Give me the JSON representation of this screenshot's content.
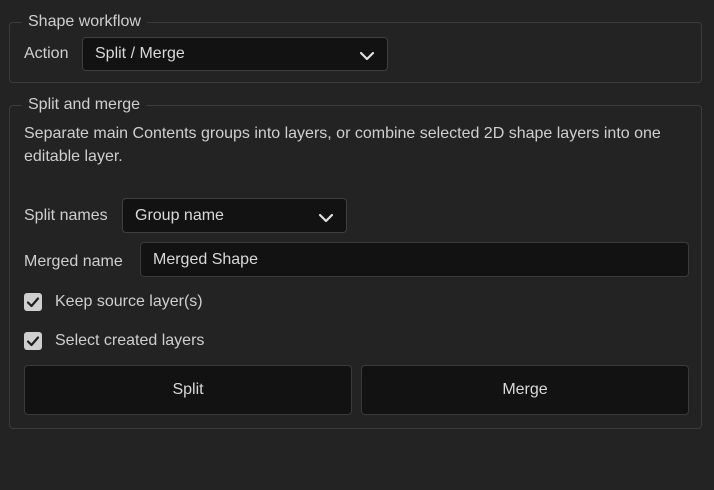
{
  "workflow": {
    "legend": "Shape workflow",
    "action_label": "Action",
    "action_value": "Split / Merge"
  },
  "split_merge": {
    "legend": "Split and merge",
    "description": "Separate main Contents groups into layers, or combine selected 2D shape layers into one editable layer.",
    "split_names_label": "Split names",
    "split_names_value": "Group name",
    "merged_name_label": "Merged name",
    "merged_name_value": "Merged Shape",
    "keep_source_label": "Keep source layer(s)",
    "keep_source_checked": true,
    "select_created_label": "Select created layers",
    "select_created_checked": true,
    "split_button": "Split",
    "merge_button": "Merge"
  },
  "icons": {
    "dropdown": "chevron-down-icon",
    "check": "checkmark-icon"
  }
}
